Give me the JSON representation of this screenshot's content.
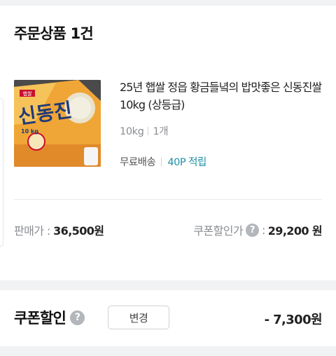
{
  "order": {
    "title": "주문상품 1건"
  },
  "product": {
    "thumbnail_text": "신동진",
    "thumbnail_brand": "햅쌀",
    "thumbnail_weight": "10 kg",
    "title": "25년 햅쌀 정읍 황금들녘의 밥맛좋은 신동진쌀 10kg (상등급)",
    "option": "10kg",
    "quantity": "1개",
    "shipping": "무료배송",
    "points": "40P 적립"
  },
  "price": {
    "sale_label": "판매가 : ",
    "sale_value": "36,500원",
    "coupon_label": "쿠폰할인가",
    "coupon_colon": ":",
    "coupon_value": "29,200 원"
  },
  "coupon": {
    "title": "쿠폰할인",
    "change_label": "변경",
    "amount": "- 7,300원"
  },
  "colors": {
    "accent_points": "#1d8fa6",
    "background": "#f1f2f4"
  }
}
